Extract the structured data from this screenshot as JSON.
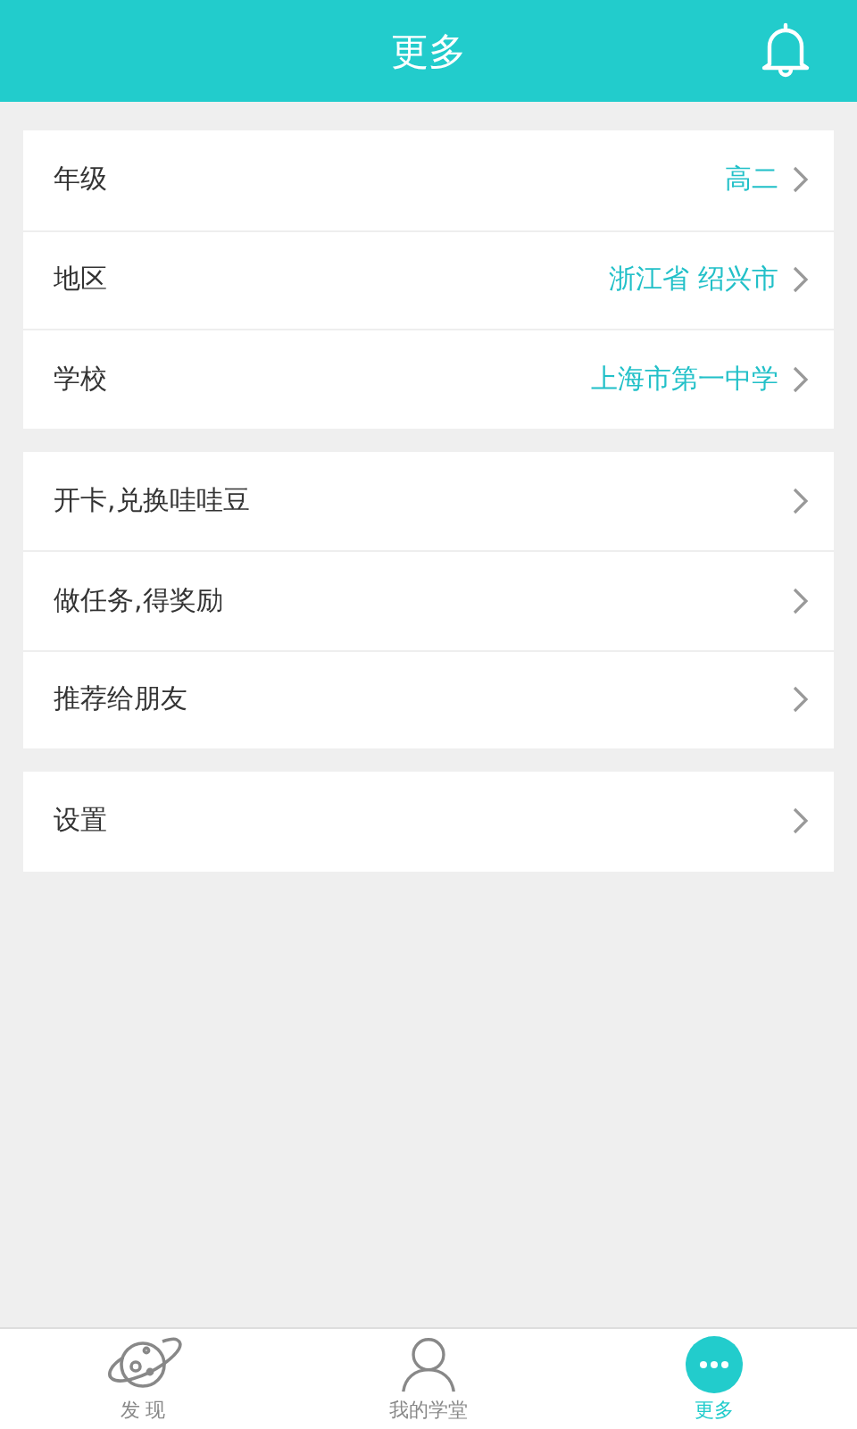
{
  "header": {
    "title": "更多"
  },
  "groups": [
    {
      "rows": [
        {
          "label": "年级",
          "value": "高二"
        },
        {
          "label": "地区",
          "value": "浙江省 绍兴市"
        },
        {
          "label": "学校",
          "value": "上海市第一中学"
        }
      ]
    },
    {
      "rows": [
        {
          "label": "开卡,兑换哇哇豆"
        },
        {
          "label": "做任务,得奖励"
        },
        {
          "label": "推荐给朋友"
        }
      ]
    },
    {
      "rows": [
        {
          "label": "设置"
        }
      ]
    }
  ],
  "tabs": [
    {
      "kind": "planet",
      "label": "发 现",
      "selected": false
    },
    {
      "kind": "person",
      "label": "我的学堂",
      "selected": false
    },
    {
      "kind": "more",
      "label": "更多",
      "selected": true
    }
  ]
}
